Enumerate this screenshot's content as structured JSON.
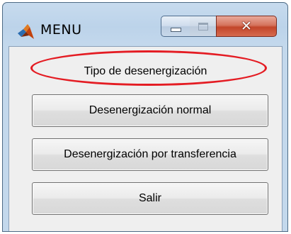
{
  "window": {
    "title": "MENU",
    "icon": "matlab-logo-icon",
    "controls": {
      "minimize": "minimize-icon",
      "maximize": "maximize-icon",
      "close": "close-icon"
    }
  },
  "panel": {
    "heading": "Tipo de desenergización",
    "buttons": [
      {
        "label": "Desenergización normal"
      },
      {
        "label": "Desenergización por transferencia"
      },
      {
        "label": "Salir"
      }
    ]
  },
  "annotation": {
    "highlight_color": "#e41c23",
    "highlighted_button": "Desenergización normal"
  },
  "colors": {
    "close_button": "#c2452a",
    "panel_bg": "#efefef",
    "frame": "#bcd3ea"
  }
}
